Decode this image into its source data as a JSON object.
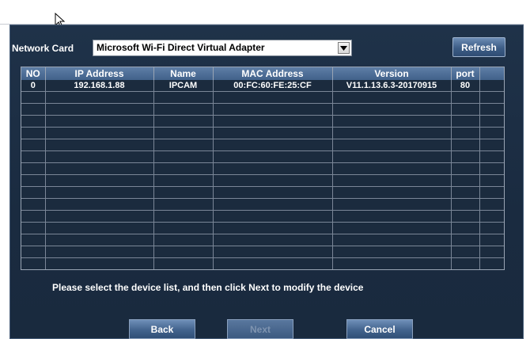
{
  "network_card": {
    "label": "Network Card",
    "selected": "Microsoft Wi-Fi Direct Virtual Adapter",
    "arrow_icon": "dropdown-arrow-icon"
  },
  "toolbar": {
    "refresh_label": "Refresh"
  },
  "table": {
    "headers": [
      "NO",
      "IP Address",
      "Name",
      "MAC Address",
      "Version",
      "port"
    ],
    "rows": [
      [
        "0",
        "192.168.1.88",
        "IPCAM",
        "00:FC:60:FE:25:CF",
        "V11.1.13.6.3-20170915",
        "80"
      ]
    ],
    "empty_row_count": 15
  },
  "message": "Please select the device list, and then click Next to modify the device",
  "buttons": {
    "back": "Back",
    "next": "Next",
    "cancel": "Cancel"
  },
  "colors": {
    "window_bg": "#1a2b40",
    "button_blue": "#42638d",
    "header_blue": "#41618a"
  }
}
